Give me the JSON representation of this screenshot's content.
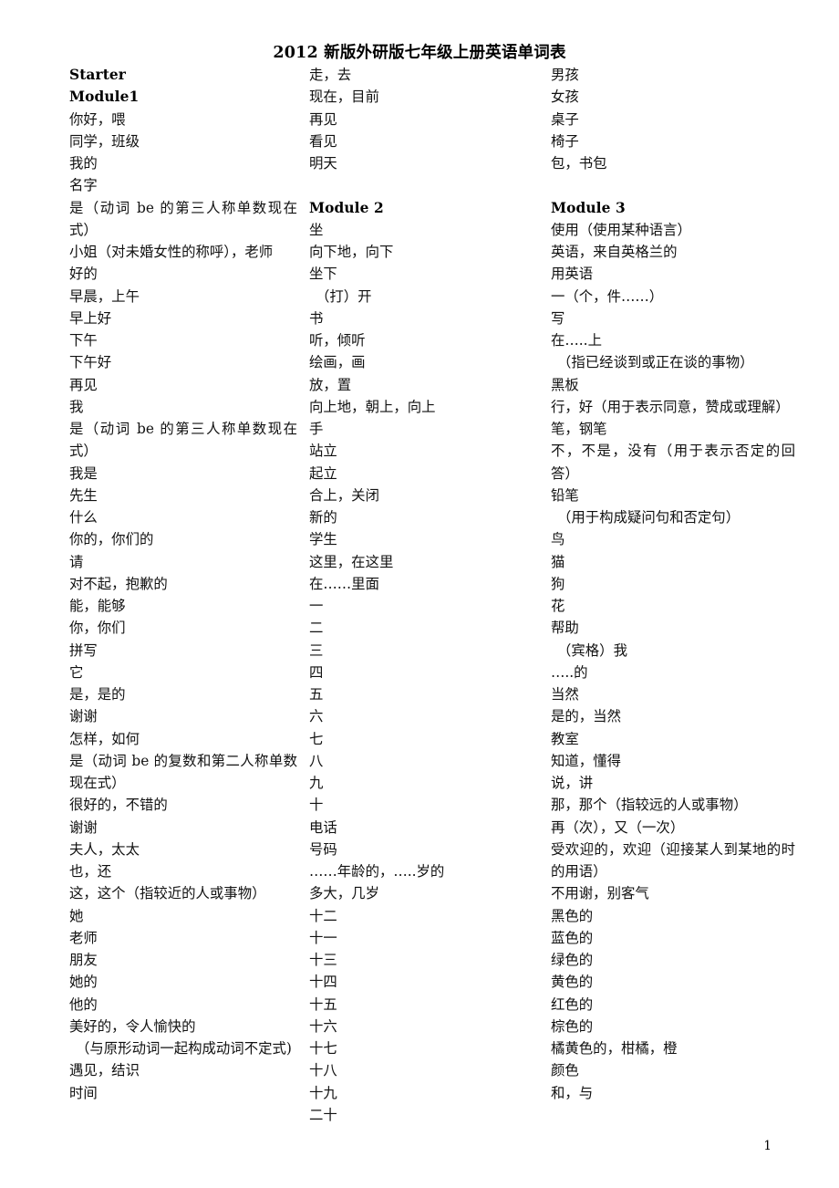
{
  "document": {
    "title": "2012 新版外研版七年级上册英语单词表",
    "page_number": "1"
  },
  "columns": [
    {
      "id": "column-1",
      "entries": [
        {
          "text": "Starter",
          "style": "head"
        },
        {
          "text": "Module1",
          "style": "head"
        },
        {
          "text": "你好，喂",
          "style": "normal"
        },
        {
          "text": "同学，班级",
          "style": "normal"
        },
        {
          "text": "我的",
          "style": "normal"
        },
        {
          "text": "名字",
          "style": "normal"
        },
        {
          "text": "是（动词 be 的第三人称单数现在式）",
          "style": "normal"
        },
        {
          "text": "小姐（对未婚女性的称呼），老师",
          "style": "normal"
        },
        {
          "text": "好的",
          "style": "normal"
        },
        {
          "text": "早晨，上午",
          "style": "normal"
        },
        {
          "text": "早上好",
          "style": "normal"
        },
        {
          "text": "下午",
          "style": "normal"
        },
        {
          "text": "下午好",
          "style": "normal"
        },
        {
          "text": "再见",
          "style": "normal"
        },
        {
          "text": "我",
          "style": "normal"
        },
        {
          "text": "是（动词 be 的第三人称单数现在式）",
          "style": "normal"
        },
        {
          "text": "我是",
          "style": "normal"
        },
        {
          "text": "先生",
          "style": "normal"
        },
        {
          "text": "什么",
          "style": "normal"
        },
        {
          "text": "你的，你们的",
          "style": "normal"
        },
        {
          "text": "请",
          "style": "normal"
        },
        {
          "text": "对不起，抱歉的",
          "style": "normal"
        },
        {
          "text": "能，能够",
          "style": "normal"
        },
        {
          "text": "你，你们",
          "style": "normal"
        },
        {
          "text": "拼写",
          "style": "normal"
        },
        {
          "text": "它",
          "style": "normal"
        },
        {
          "text": "是，是的",
          "style": "normal"
        },
        {
          "text": "谢谢",
          "style": "normal"
        },
        {
          "text": "怎样，如何",
          "style": "normal"
        },
        {
          "text": "是（动词 be 的复数和第二人称单数现在式）",
          "style": "normal"
        },
        {
          "text": "很好的，不错的",
          "style": "normal"
        },
        {
          "text": "谢谢",
          "style": "normal"
        },
        {
          "text": "夫人，太太",
          "style": "normal"
        },
        {
          "text": "也，还",
          "style": "normal"
        },
        {
          "text": "这，这个（指较近的人或事物）",
          "style": "normal"
        },
        {
          "text": "她",
          "style": "normal"
        },
        {
          "text": "老师",
          "style": "normal"
        },
        {
          "text": "朋友",
          "style": "normal"
        },
        {
          "text": "她的",
          "style": "normal"
        },
        {
          "text": "他的",
          "style": "normal"
        },
        {
          "text": "美好的，令人愉快的",
          "style": "normal"
        },
        {
          "text": "（与原形动词一起构成动词不定式)",
          "style": "indent"
        },
        {
          "text": "遇见，结识",
          "style": "normal"
        },
        {
          "text": "时间",
          "style": "normal"
        }
      ]
    },
    {
      "id": "column-2",
      "entries": [
        {
          "text": "走，去",
          "style": "normal"
        },
        {
          "text": "现在，目前",
          "style": "normal"
        },
        {
          "text": "再见",
          "style": "normal"
        },
        {
          "text": "看见",
          "style": "normal"
        },
        {
          "text": "明天",
          "style": "normal"
        },
        {
          "text": "",
          "style": "spacer"
        },
        {
          "text": "Module 2",
          "style": "head"
        },
        {
          "text": "坐",
          "style": "normal"
        },
        {
          "text": "向下地，向下",
          "style": "normal"
        },
        {
          "text": "坐下",
          "style": "normal"
        },
        {
          "text": "（打）开",
          "style": "indent"
        },
        {
          "text": "书",
          "style": "normal"
        },
        {
          "text": "听，倾听",
          "style": "normal"
        },
        {
          "text": "绘画，画",
          "style": "normal"
        },
        {
          "text": "放，置",
          "style": "normal"
        },
        {
          "text": "向上地，朝上，向上",
          "style": "normal"
        },
        {
          "text": "手",
          "style": "normal"
        },
        {
          "text": "站立",
          "style": "normal"
        },
        {
          "text": "起立",
          "style": "normal"
        },
        {
          "text": "合上，关闭",
          "style": "normal"
        },
        {
          "text": "新的",
          "style": "normal"
        },
        {
          "text": "学生",
          "style": "normal"
        },
        {
          "text": "这里，在这里",
          "style": "normal"
        },
        {
          "text": "在……里面",
          "style": "normal"
        },
        {
          "text": "一",
          "style": "normal"
        },
        {
          "text": "二",
          "style": "normal"
        },
        {
          "text": "三",
          "style": "normal"
        },
        {
          "text": "四",
          "style": "normal"
        },
        {
          "text": "五",
          "style": "normal"
        },
        {
          "text": "六",
          "style": "normal"
        },
        {
          "text": "七",
          "style": "normal"
        },
        {
          "text": "八",
          "style": "normal"
        },
        {
          "text": "九",
          "style": "normal"
        },
        {
          "text": "十",
          "style": "normal"
        },
        {
          "text": "电话",
          "style": "normal"
        },
        {
          "text": "号码",
          "style": "normal"
        },
        {
          "text": "……年龄的，…..岁的",
          "style": "normal"
        },
        {
          "text": "多大，几岁",
          "style": "normal"
        },
        {
          "text": "十二",
          "style": "normal"
        },
        {
          "text": "十一",
          "style": "normal"
        },
        {
          "text": "十三",
          "style": "normal"
        },
        {
          "text": "十四",
          "style": "normal"
        },
        {
          "text": "十五",
          "style": "normal"
        },
        {
          "text": "十六",
          "style": "normal"
        },
        {
          "text": "十七",
          "style": "normal"
        },
        {
          "text": "十八",
          "style": "normal"
        },
        {
          "text": "十九",
          "style": "normal"
        },
        {
          "text": "二十",
          "style": "normal"
        }
      ]
    },
    {
      "id": "column-3",
      "entries": [
        {
          "text": "男孩",
          "style": "normal"
        },
        {
          "text": "女孩",
          "style": "normal"
        },
        {
          "text": "桌子",
          "style": "normal"
        },
        {
          "text": "椅子",
          "style": "normal"
        },
        {
          "text": "包，书包",
          "style": "normal"
        },
        {
          "text": "",
          "style": "spacer"
        },
        {
          "text": "Module 3",
          "style": "head"
        },
        {
          "text": "使用（使用某种语言）",
          "style": "normal"
        },
        {
          "text": "英语，来自英格兰的",
          "style": "normal"
        },
        {
          "text": "用英语",
          "style": "normal"
        },
        {
          "text": "一（个，件……）",
          "style": "normal"
        },
        {
          "text": "写",
          "style": "normal"
        },
        {
          "text": "在…..上",
          "style": "normal"
        },
        {
          "text": "（指已经谈到或正在谈的事物）",
          "style": "indent"
        },
        {
          "text": "黑板",
          "style": "normal"
        },
        {
          "text": "行，好（用于表示同意，赞成或理解）",
          "style": "normal"
        },
        {
          "text": "笔，钢笔",
          "style": "normal"
        },
        {
          "text": "不，不是，没有（用于表示否定的回答）",
          "style": "normal"
        },
        {
          "text": "铅笔",
          "style": "normal"
        },
        {
          "text": "（用于构成疑问句和否定句）",
          "style": "indent"
        },
        {
          "text": "鸟",
          "style": "normal"
        },
        {
          "text": "猫",
          "style": "normal"
        },
        {
          "text": "狗",
          "style": "normal"
        },
        {
          "text": "花",
          "style": "normal"
        },
        {
          "text": "帮助",
          "style": "normal"
        },
        {
          "text": "（宾格）我",
          "style": "indent"
        },
        {
          "text": "…..的",
          "style": "normal"
        },
        {
          "text": "当然",
          "style": "normal"
        },
        {
          "text": "是的，当然",
          "style": "normal"
        },
        {
          "text": "教室",
          "style": "normal"
        },
        {
          "text": "知道，懂得",
          "style": "normal"
        },
        {
          "text": "说，讲",
          "style": "normal"
        },
        {
          "text": "那，那个（指较远的人或事物）",
          "style": "normal"
        },
        {
          "text": "再（次），又（一次）",
          "style": "normal"
        },
        {
          "text": "受欢迎的，欢迎（迎接某人到某地的时的用语）",
          "style": "normal"
        },
        {
          "text": "不用谢，别客气",
          "style": "normal"
        },
        {
          "text": "黑色的",
          "style": "normal"
        },
        {
          "text": "蓝色的",
          "style": "normal"
        },
        {
          "text": "绿色的",
          "style": "normal"
        },
        {
          "text": "黄色的",
          "style": "normal"
        },
        {
          "text": "红色的",
          "style": "normal"
        },
        {
          "text": "棕色的",
          "style": "normal"
        },
        {
          "text": "橘黄色的，柑橘，橙",
          "style": "normal"
        },
        {
          "text": "颜色",
          "style": "normal"
        },
        {
          "text": "和，与",
          "style": "normal"
        }
      ]
    }
  ]
}
